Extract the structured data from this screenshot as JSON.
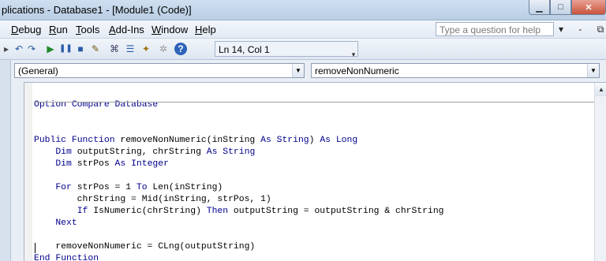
{
  "window": {
    "title": "plications - Database1 - [Module1 (Code)]",
    "buttons": {
      "minimize": "▁",
      "maximize": "□",
      "close": "✕"
    }
  },
  "menu": {
    "items": [
      {
        "label": "Debug",
        "underline": "D"
      },
      {
        "label": "Run",
        "underline": "R"
      },
      {
        "label": "Tools",
        "underline": "T"
      },
      {
        "label": "Add-Ins",
        "underline": "A"
      },
      {
        "label": "Window",
        "underline": "W"
      },
      {
        "label": "Help",
        "underline": "H"
      }
    ],
    "ask_placeholder": "Type a question for help",
    "mdi_controls": "▾ - ⧉ ✕"
  },
  "toolbar": {
    "icons": [
      "undo-icon",
      "redo-icon",
      "run-icon",
      "break-icon",
      "reset-icon",
      "design-mode-icon",
      "project-explorer-icon",
      "properties-icon",
      "object-browser-icon",
      "toolbox-icon",
      "help-icon"
    ],
    "position": "Ln 14, Col 1"
  },
  "code_window": {
    "object_combo": "(General)",
    "procedure_combo": "removeNonNumeric"
  },
  "code": {
    "header": "Option Compare Database",
    "lines": [
      "Public Function removeNonNumeric(inString As String) As Long",
      "    Dim outputString, chrString As String",
      "    Dim strPos As Integer",
      "",
      "    For strPos = 1 To Len(inString)",
      "        chrString = Mid(inString, strPos, 1)",
      "        If IsNumeric(chrString) Then outputString = outputString & chrString",
      "    Next",
      "",
      "    removeNonNumeric = CLng(outputString)",
      "End Function"
    ]
  },
  "colors": {
    "keyword": "#00008b"
  }
}
